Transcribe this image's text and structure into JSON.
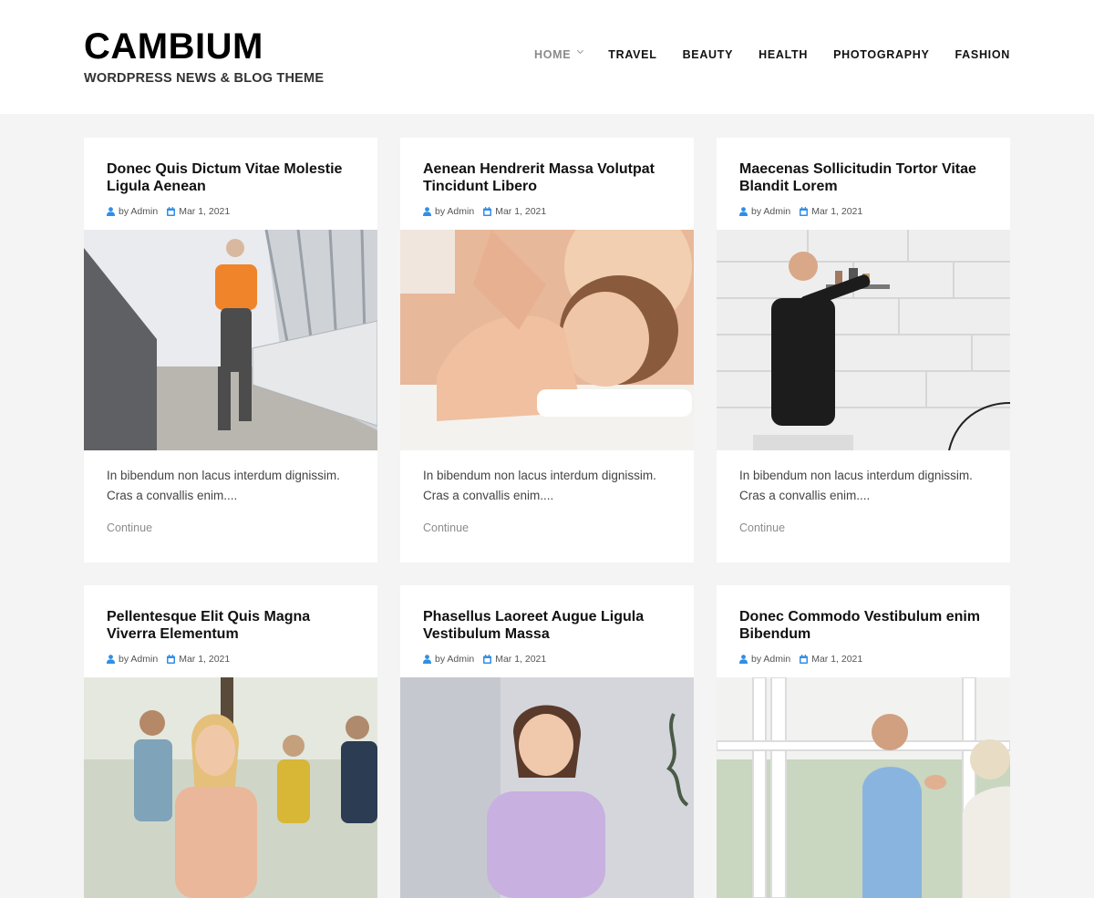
{
  "site": {
    "title": "CAMBIUM",
    "description": "WORDPRESS NEWS & BLOG THEME"
  },
  "nav": {
    "items": [
      {
        "label": "HOME",
        "active": true,
        "has_submenu": true
      },
      {
        "label": "TRAVEL"
      },
      {
        "label": "BEAUTY"
      },
      {
        "label": "HEALTH"
      },
      {
        "label": "PHOTOGRAPHY"
      },
      {
        "label": "FASHION"
      }
    ]
  },
  "icons": {
    "author": "user-icon",
    "date": "calendar-icon"
  },
  "colors": {
    "accent": "#2f8ee8",
    "header_bg": "#ffffff",
    "page_bg": "#f4f4f4"
  },
  "posts": [
    {
      "title": "Donec Quis Dictum Vitae Molestie Ligula Aenean",
      "author": "by Admin",
      "date": "Mar 1, 2021",
      "excerpt": "In bibendum non lacus interdum dignissim. Cras a convallis enim....",
      "continue": "Continue"
    },
    {
      "title": "Aenean Hendrerit Massa Volutpat Tincidunt Libero",
      "author": "by Admin",
      "date": "Mar 1, 2021",
      "excerpt": "In bibendum non lacus interdum dignissim. Cras a convallis enim....",
      "continue": "Continue"
    },
    {
      "title": "Maecenas Sollicitudin Tortor Vitae Blandit Lorem",
      "author": "by Admin",
      "date": "Mar 1, 2021",
      "excerpt": "In bibendum non lacus interdum dignissim. Cras a convallis enim....",
      "continue": "Continue"
    },
    {
      "title": "Pellentesque Elit Quis Magna Viverra Elementum",
      "author": "by Admin",
      "date": "Mar 1, 2021"
    },
    {
      "title": "Phasellus Laoreet Augue Ligula Vestibulum Massa",
      "author": "by Admin",
      "date": "Mar 1, 2021"
    },
    {
      "title": "Donec Commodo Vestibulum enim Bibendum",
      "author": "by Admin",
      "date": "Mar 1, 2021"
    }
  ]
}
